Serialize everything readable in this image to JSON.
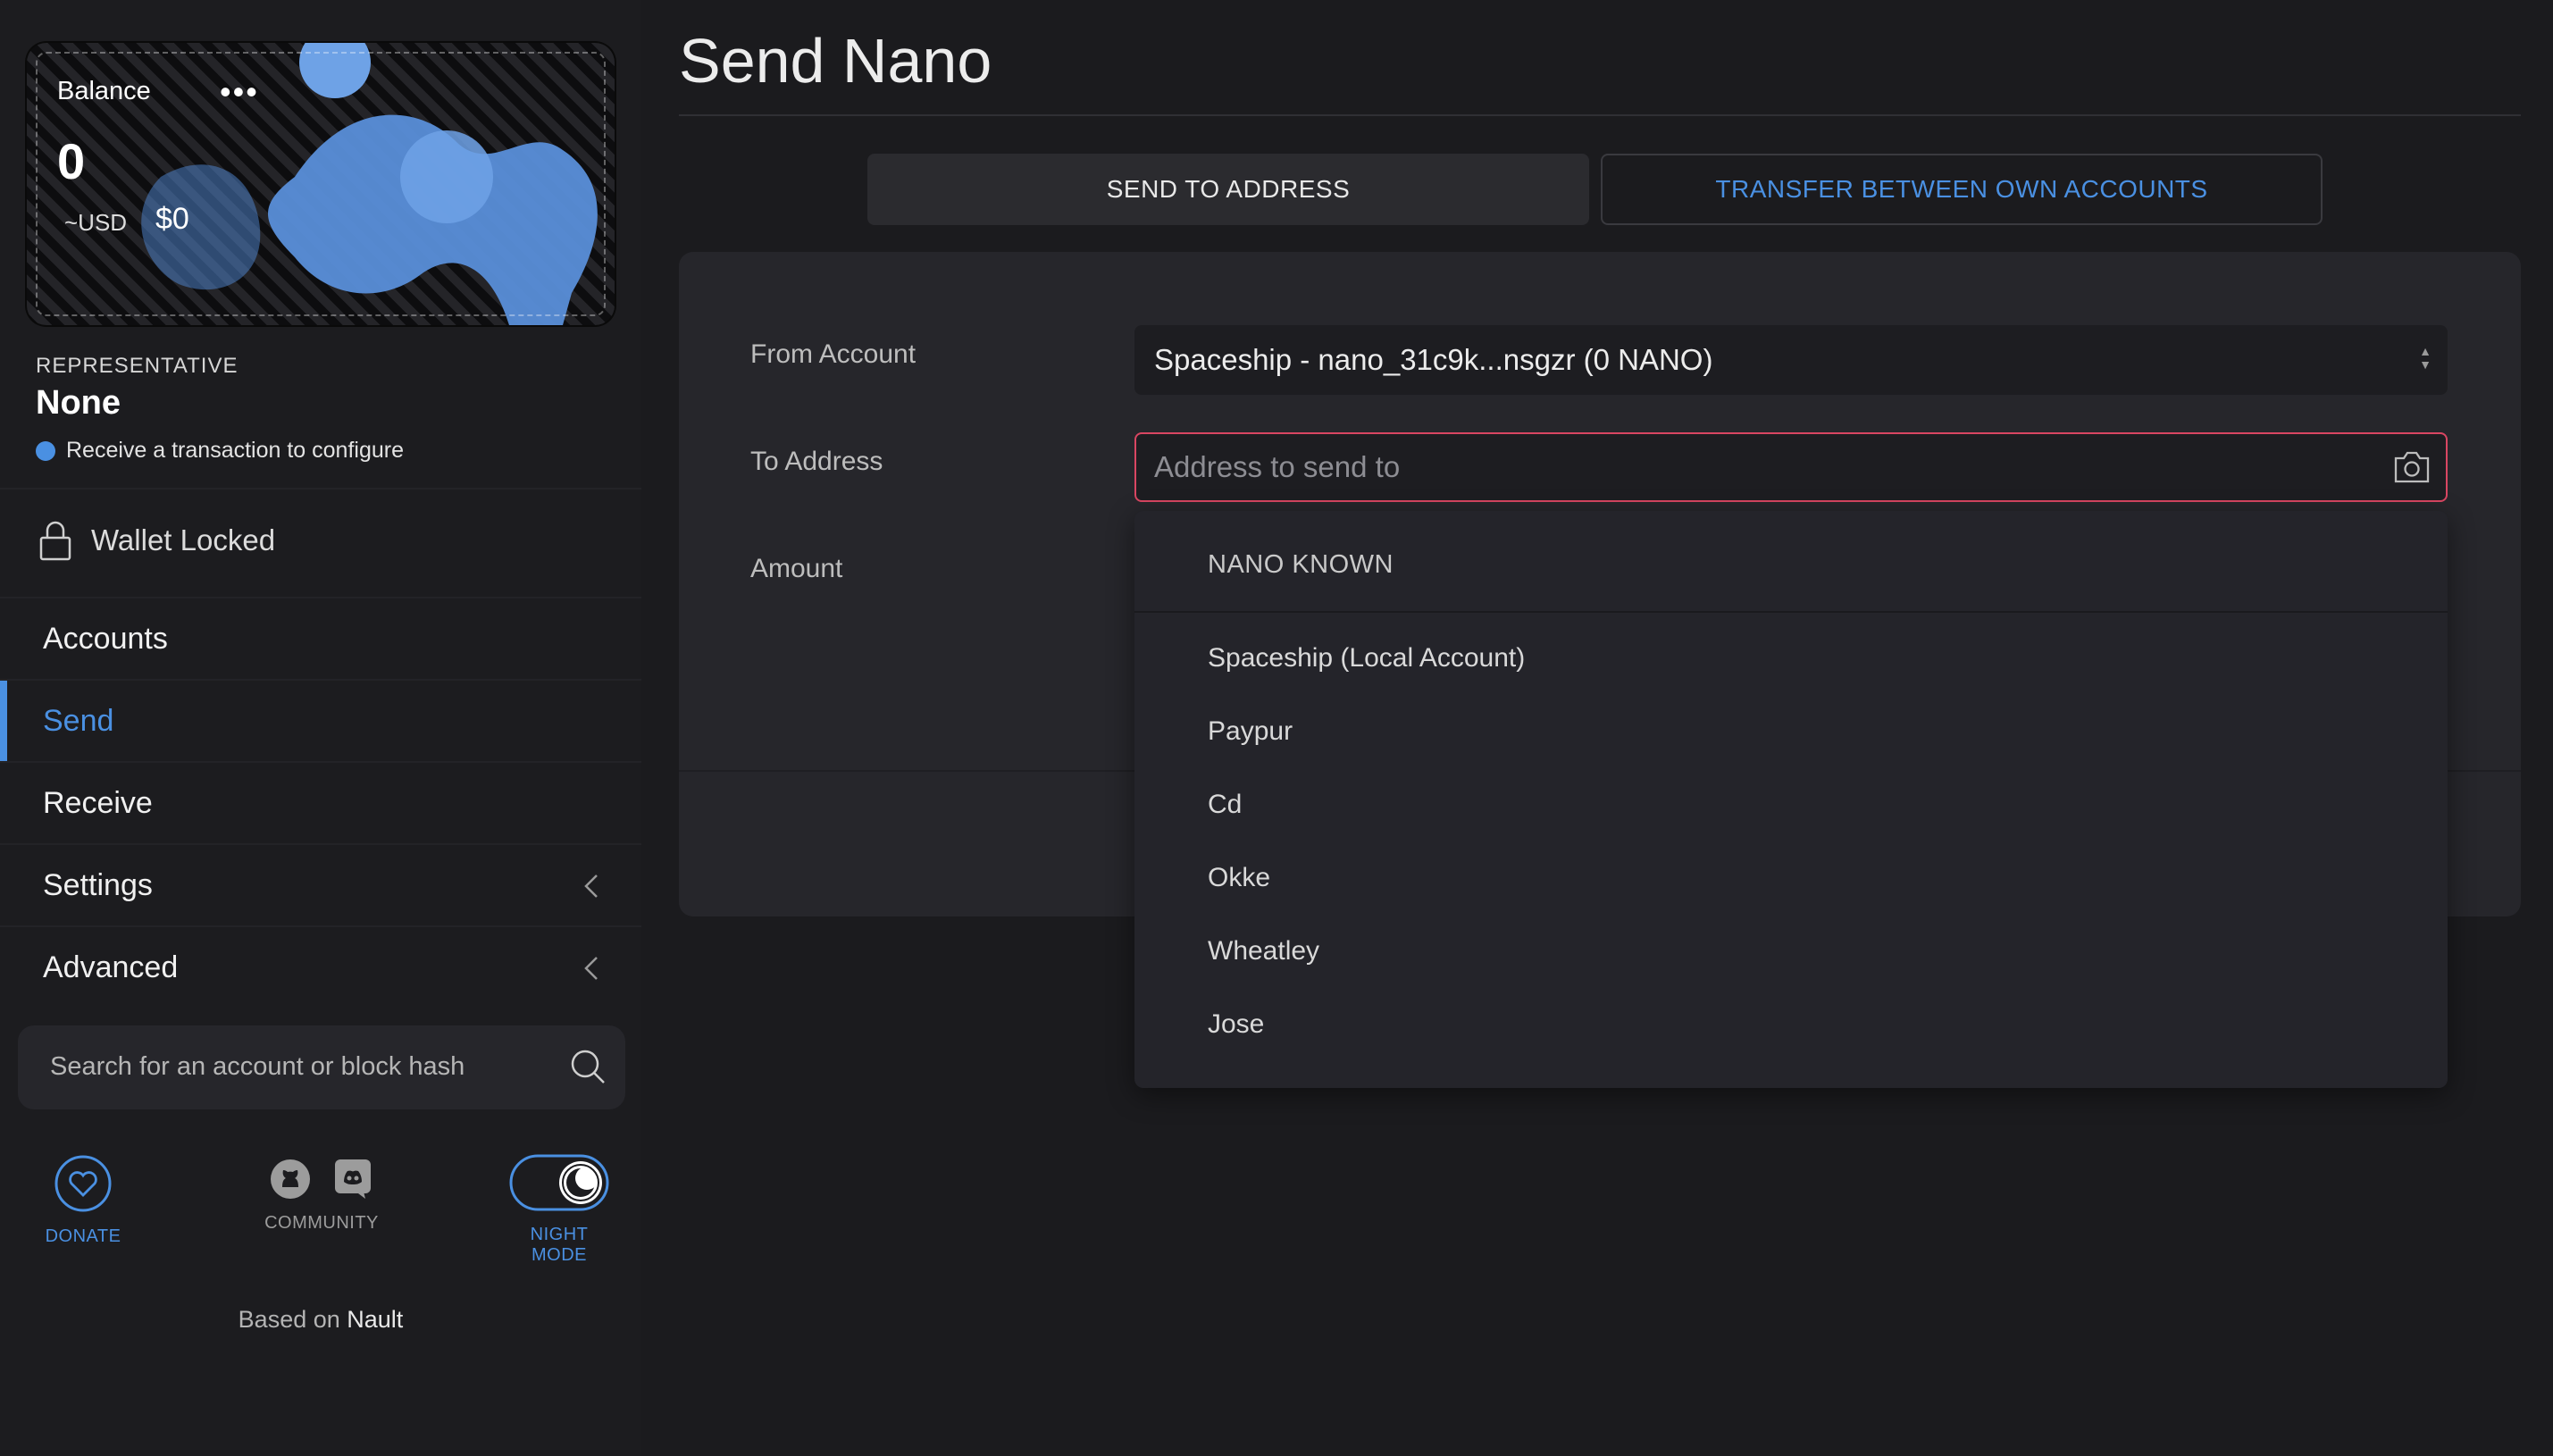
{
  "balance": {
    "label": "Balance",
    "menu_icon": "more-dots-icon",
    "value": "0",
    "currency_label": "~USD",
    "currency_value": "$0"
  },
  "representative": {
    "title": "REPRESENTATIVE",
    "value": "None",
    "note": "Receive a transaction to configure",
    "dot_color": "#4a90e2"
  },
  "wallet": {
    "status": "Wallet Locked",
    "icon": "lock-icon"
  },
  "nav": {
    "items": [
      {
        "label": "Accounts"
      },
      {
        "label": "Send",
        "active": true
      },
      {
        "label": "Receive"
      },
      {
        "label": "Settings",
        "expandable": true
      },
      {
        "label": "Advanced",
        "expandable": true
      }
    ]
  },
  "search": {
    "placeholder": "Search for an account or block hash",
    "icon": "search-icon"
  },
  "footer": {
    "donate_label": "DONATE",
    "community_label": "COMMUNITY",
    "night_mode_label": "NIGHT MODE",
    "based_on_prefix": "Based on",
    "based_on_name": "Nault"
  },
  "main": {
    "title": "Send Nano",
    "tabs": [
      {
        "label": "SEND TO ADDRESS",
        "active": true
      },
      {
        "label": "TRANSFER BETWEEN OWN ACCOUNTS"
      }
    ],
    "form": {
      "from_label": "From Account",
      "from_value": "Spaceship - nano_31c9k...nsgzr (0 NANO)",
      "to_label": "To Address",
      "to_placeholder": "Address to send to",
      "amount_label": "Amount"
    },
    "dropdown": {
      "header": "NANO KNOWN",
      "items": [
        "Spaceship (Local Account)",
        "Paypur",
        "Cd",
        "Okke",
        "Wheatley",
        "Jose"
      ]
    }
  },
  "colors": {
    "accent": "#4a90e2",
    "error_border": "#d94662",
    "background": "#1b1b1e"
  }
}
